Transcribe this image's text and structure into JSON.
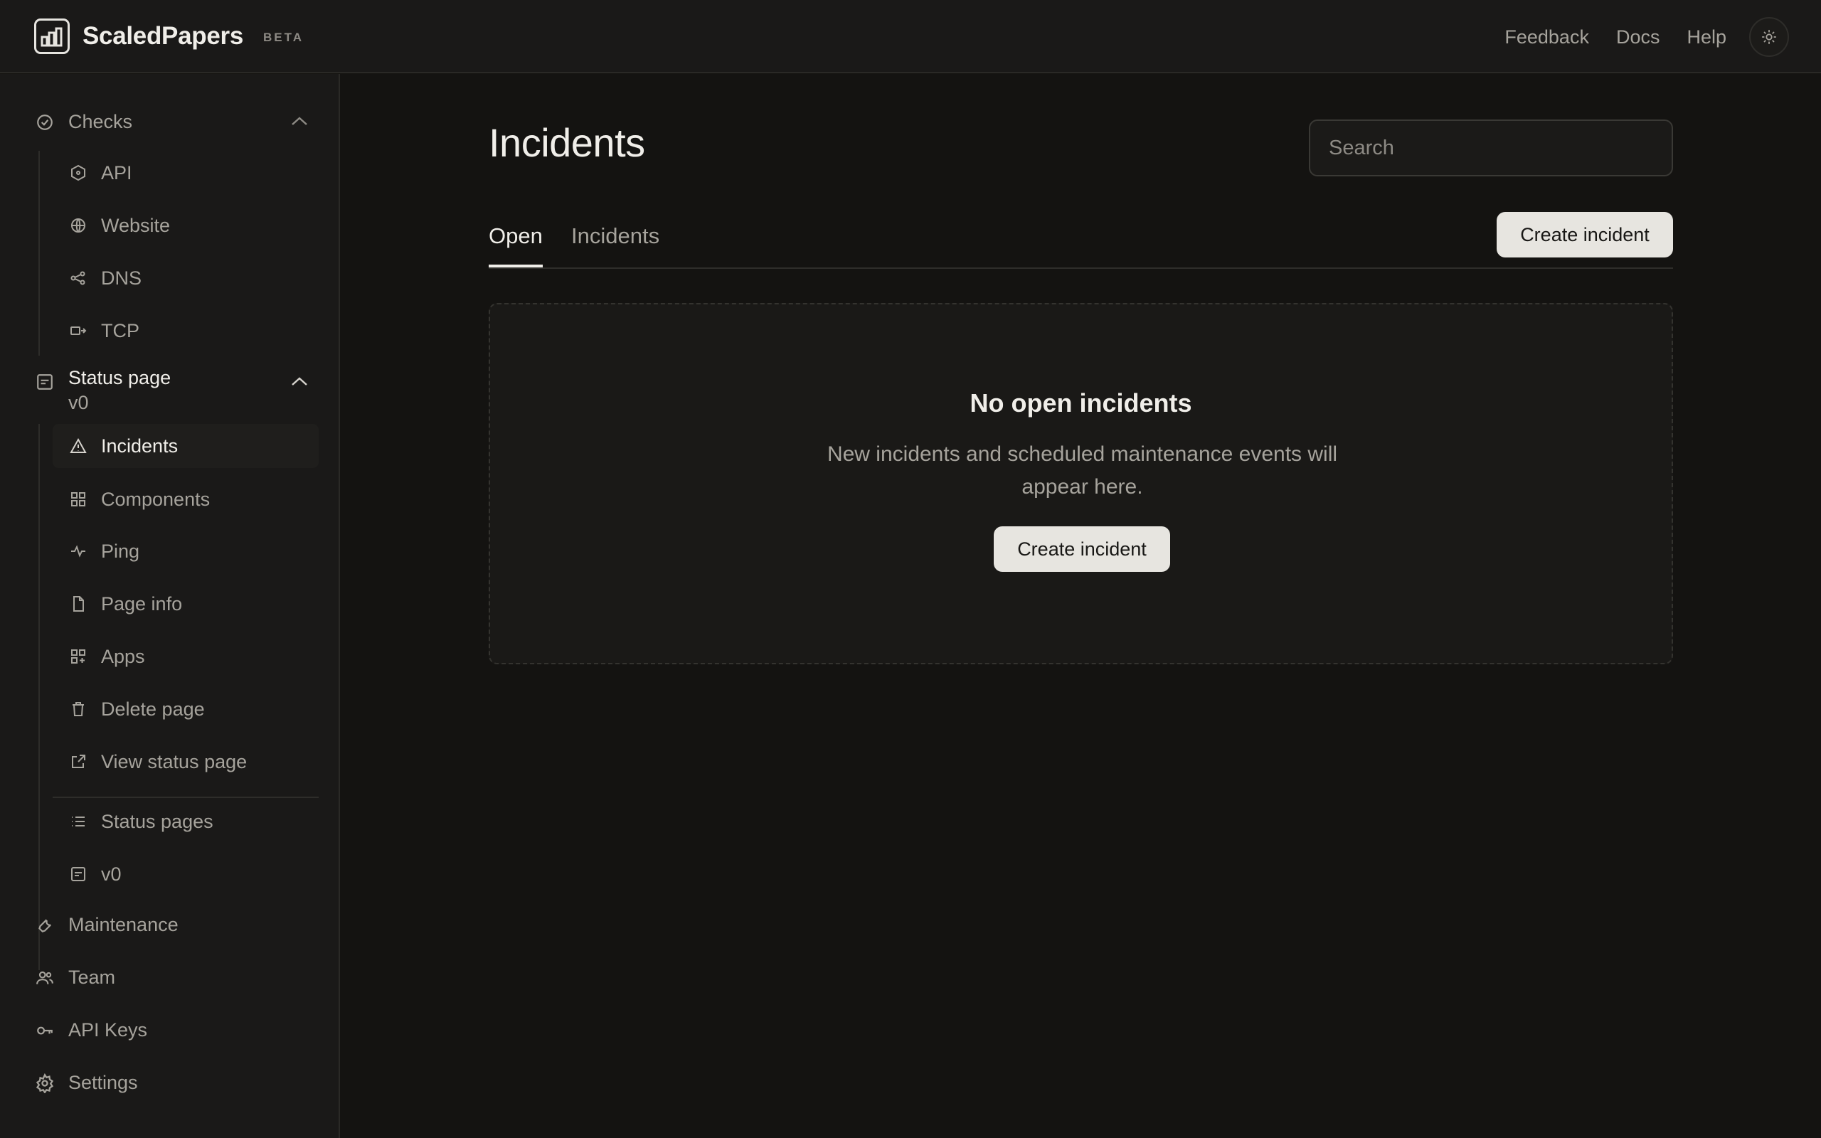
{
  "app": {
    "name": "ScaledPapers",
    "badge": "BETA"
  },
  "topnav": {
    "feedback": "Feedback",
    "docs": "Docs",
    "help": "Help"
  },
  "sidebar": {
    "checks": {
      "label": "Checks",
      "items": [
        "API",
        "Website",
        "DNS",
        "TCP"
      ]
    },
    "status_page": {
      "label": "Status page",
      "version": "v0",
      "items": [
        "Incidents",
        "Components",
        "Ping",
        "Page info",
        "Apps",
        "Delete page",
        "View status page"
      ],
      "extra": [
        "Status pages",
        "v0"
      ]
    },
    "bottom": [
      "Maintenance",
      "Team",
      "API Keys",
      "Settings"
    ]
  },
  "main": {
    "title": "Incidents",
    "search_placeholder": "Search",
    "tabs": [
      "Open",
      "Incidents"
    ],
    "create_button": "Create incident",
    "empty": {
      "title": "No open incidents",
      "description": "New incidents and scheduled maintenance events will appear here.",
      "button": "Create incident"
    }
  }
}
